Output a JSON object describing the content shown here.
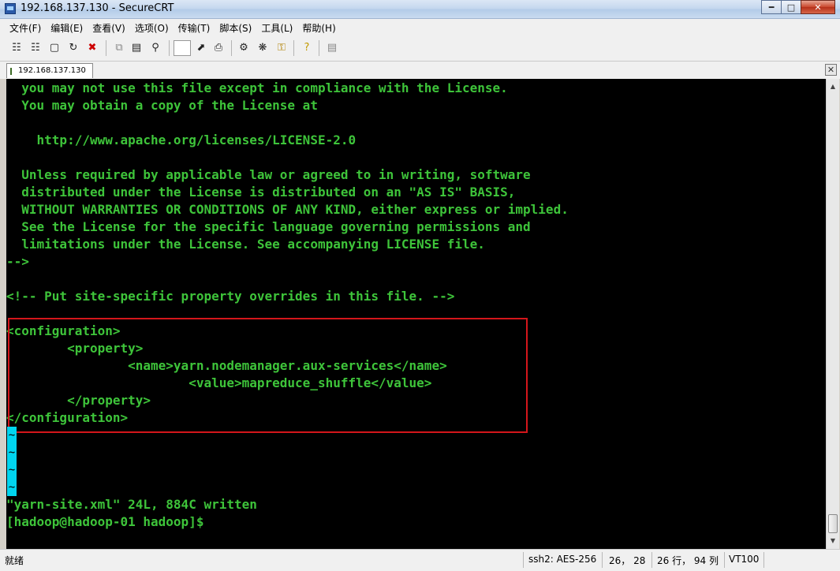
{
  "window": {
    "title": "192.168.137.130 - SecureCRT"
  },
  "menu": [
    "文件(F)",
    "编辑(E)",
    "查看(V)",
    "选项(O)",
    "传输(T)",
    "脚本(S)",
    "工具(L)",
    "帮助(H)"
  ],
  "toolbar": {
    "icons": [
      "connect-icon",
      "quick-connect-icon",
      "connect-tab-icon",
      "reconnect-icon",
      "disconnect-icon",
      "copy-icon",
      "paste-icon",
      "find-icon",
      "command-input",
      "cursor-icon",
      "print-icon",
      "session-options-icon",
      "global-options-icon",
      "keymap-icon",
      "help-icon",
      "log-icon"
    ]
  },
  "tab": {
    "label": "192.168.137.130"
  },
  "terminal": {
    "lines": [
      "  you may not use this file except in compliance with the License.",
      "  You may obtain a copy of the License at",
      "",
      "    http://www.apache.org/licenses/LICENSE-2.0",
      "",
      "  Unless required by applicable law or agreed to in writing, software",
      "  distributed under the License is distributed on an \"AS IS\" BASIS,",
      "  WITHOUT WARRANTIES OR CONDITIONS OF ANY KIND, either express or implied.",
      "  See the License for the specific language governing permissions and",
      "  limitations under the License. See accompanying LICENSE file.",
      "-->",
      "",
      "<!-- Put site-specific property overrides in this file. -->",
      "",
      "<configuration>",
      "        <property>",
      "                <name>yarn.nodemanager.aux-services</name>",
      "                        <value>mapreduce_shuffle</value>",
      "        </property>",
      "</configuration>"
    ],
    "tildes": [
      "~",
      "~",
      "~",
      "~"
    ],
    "written_msg": "\"yarn-site.xml\" 24L, 884C written",
    "prompt": "[hadoop@hadoop-01 hadoop]$"
  },
  "status": {
    "ready": "就绪",
    "protocol": "ssh2: AES-256",
    "cursor_pos": "26， 28",
    "rows_cols": "26 行， 94 列",
    "emulation": "VT100"
  },
  "colors": {
    "terminal_bg": "#000000",
    "terminal_text": "#3ec43a",
    "highlight_box": "#d4161b",
    "tilde_bg": "#00d5f0"
  }
}
